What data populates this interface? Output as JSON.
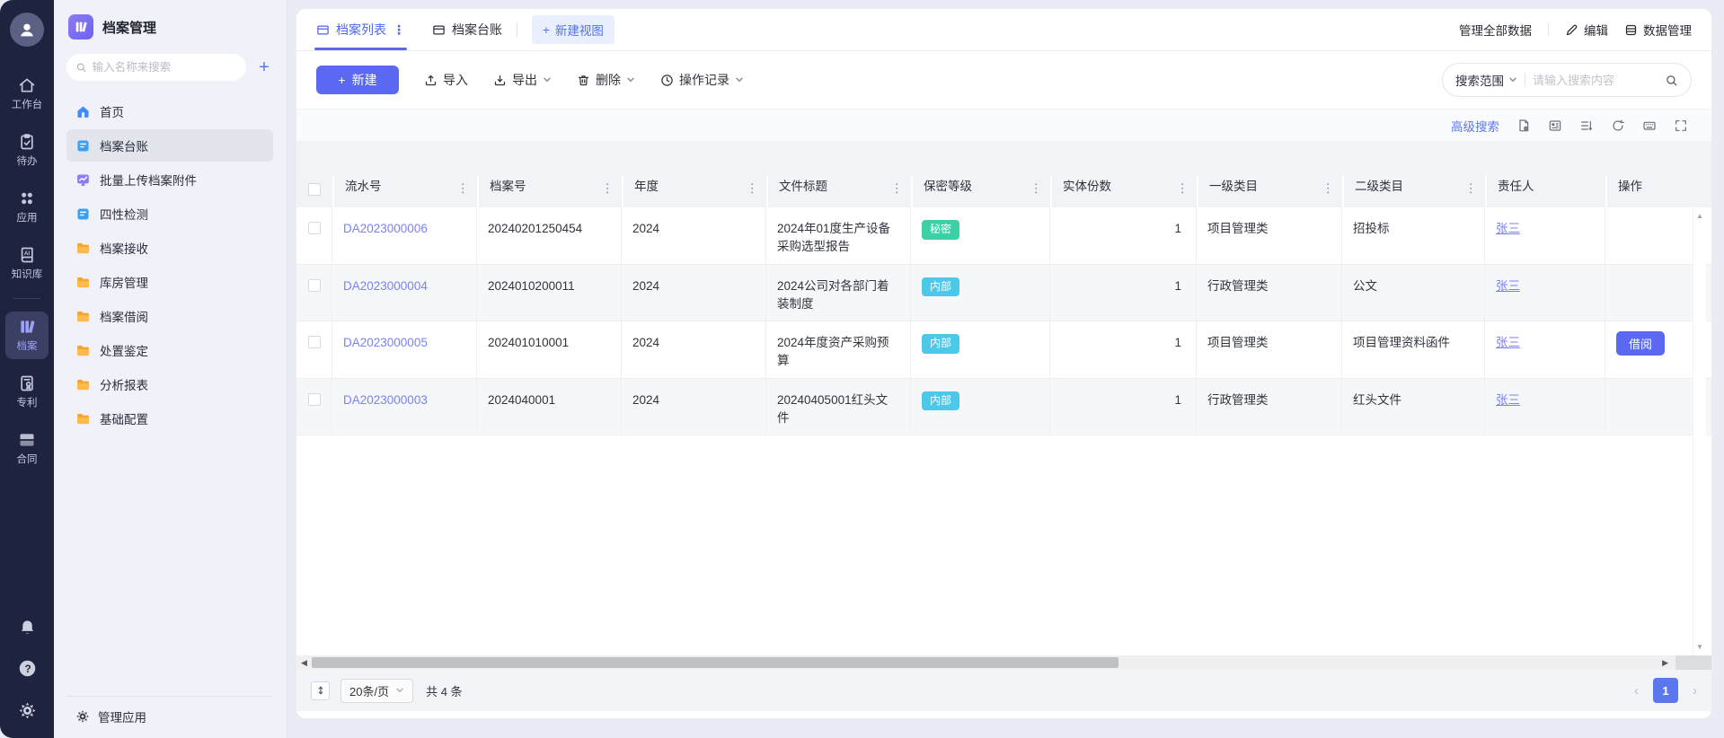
{
  "app_title": "档案管理",
  "rail": {
    "items": [
      {
        "label": "工作台"
      },
      {
        "label": "待办"
      },
      {
        "label": "应用"
      },
      {
        "label": "知识库"
      },
      {
        "label": "档案",
        "active": true
      },
      {
        "label": "专利"
      },
      {
        "label": "合同"
      }
    ]
  },
  "sidebar": {
    "search_placeholder": "输入名称来搜索",
    "items": [
      {
        "label": "首页"
      },
      {
        "label": "档案台账",
        "active": true
      },
      {
        "label": "批量上传档案附件"
      },
      {
        "label": "四性检测"
      },
      {
        "label": "档案接收"
      },
      {
        "label": "库房管理"
      },
      {
        "label": "档案借阅"
      },
      {
        "label": "处置鉴定"
      },
      {
        "label": "分析报表"
      },
      {
        "label": "基础配置"
      }
    ],
    "manage_label": "管理应用"
  },
  "view_tabs": {
    "tab1": "档案列表",
    "tab2": "档案台账",
    "new_view": "新建视图"
  },
  "header_actions": {
    "manage_all": "管理全部数据",
    "edit": "编辑",
    "data_manage": "数据管理"
  },
  "toolbar": {
    "new": "新建",
    "import": "导入",
    "export": "导出",
    "delete": "删除",
    "op_log": "操作记录"
  },
  "search": {
    "scope_label": "搜索范围",
    "placeholder": "请输入搜索内容"
  },
  "table_tools": {
    "advanced_search": "高级搜索"
  },
  "table": {
    "columns": [
      "流水号",
      "档案号",
      "年度",
      "文件标题",
      "保密等级",
      "实体份数",
      "一级类目",
      "二级类目",
      "责任人",
      "操作"
    ],
    "rows": [
      {
        "serial": "DA2023000006",
        "archive_no": "20240201250454",
        "year": "2024",
        "title": "2024年01度生产设备采购选型报告",
        "security_level": "秘密",
        "level_variant": "green",
        "copies": "1",
        "category1": "项目管理类",
        "category2": "招投标",
        "owner": "张三",
        "action": ""
      },
      {
        "serial": "DA2023000004",
        "archive_no": "2024010200011",
        "year": "2024",
        "title": "2024公司对各部门着装制度",
        "security_level": "内部",
        "level_variant": "cyan",
        "copies": "1",
        "category1": "行政管理类",
        "category2": "公文",
        "owner": "张三",
        "action": ""
      },
      {
        "serial": "DA2023000005",
        "archive_no": "202401010001",
        "year": "2024",
        "title": "2024年度资产采购预算",
        "security_level": "内部",
        "level_variant": "cyan",
        "copies": "1",
        "category1": "项目管理类",
        "category2": "项目管理资料函件",
        "owner": "张三",
        "action": "借阅"
      },
      {
        "serial": "DA2023000003",
        "archive_no": "2024040001",
        "year": "2024",
        "title": "20240405001红头文件",
        "security_level": "内部",
        "level_variant": "cyan",
        "copies": "1",
        "category1": "行政管理类",
        "category2": "红头文件",
        "owner": "张三",
        "action": ""
      }
    ]
  },
  "pagination": {
    "page_size": "20条/页",
    "total": "共 4 条",
    "current_page": "1"
  },
  "colors": {
    "accent": "#5b68f2",
    "link": "#7b82ee",
    "badge_green": "#3ed0a5",
    "badge_cyan": "#4cc8e8",
    "rail_bg": "#1e2340",
    "active_tab": "#4c66ee"
  }
}
